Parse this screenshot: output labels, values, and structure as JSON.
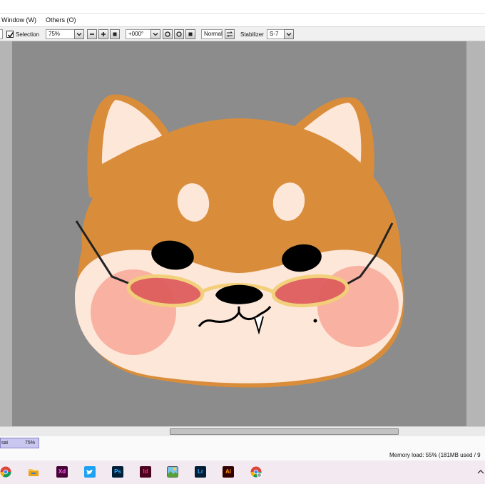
{
  "menubar": {
    "window": "Window (W)",
    "others": "Others (O)"
  },
  "toolbar": {
    "selection_label": "Selection",
    "selection_checked": true,
    "zoom": "75%",
    "rotation": "+000°",
    "blend_mode": "Normal",
    "stabilizer_label": "Stabilizer",
    "stabilizer_value": "S-7"
  },
  "document_tab": {
    "name": "sai",
    "zoom": "75%"
  },
  "status": {
    "memory": "Memory load: 55% (181MB used / 9"
  },
  "taskbar": {
    "apps": [
      {
        "icon": "chrome-icon"
      },
      {
        "icon": "file-explorer-icon"
      },
      {
        "icon": "adobe-xd-icon",
        "text": "Xd"
      },
      {
        "icon": "twitter-icon"
      },
      {
        "icon": "photoshop-icon",
        "text": "Ps"
      },
      {
        "icon": "indesign-icon",
        "text": "Id"
      },
      {
        "icon": "landscape-app-icon"
      },
      {
        "icon": "lightroom-icon",
        "text": "Lr"
      },
      {
        "icon": "illustrator-icon",
        "text": "Ai"
      },
      {
        "icon": "chrome-profile-icon"
      }
    ]
  },
  "colors": {
    "canvas_bg": "#8c8c8c",
    "fur": "#d98d3a",
    "cream": "#fde7d9",
    "blush": "#f8a798",
    "glasses_frame": "#f2cf78",
    "glasses_lens": "#de5d5d",
    "taskbar": "#f3e9f1"
  }
}
